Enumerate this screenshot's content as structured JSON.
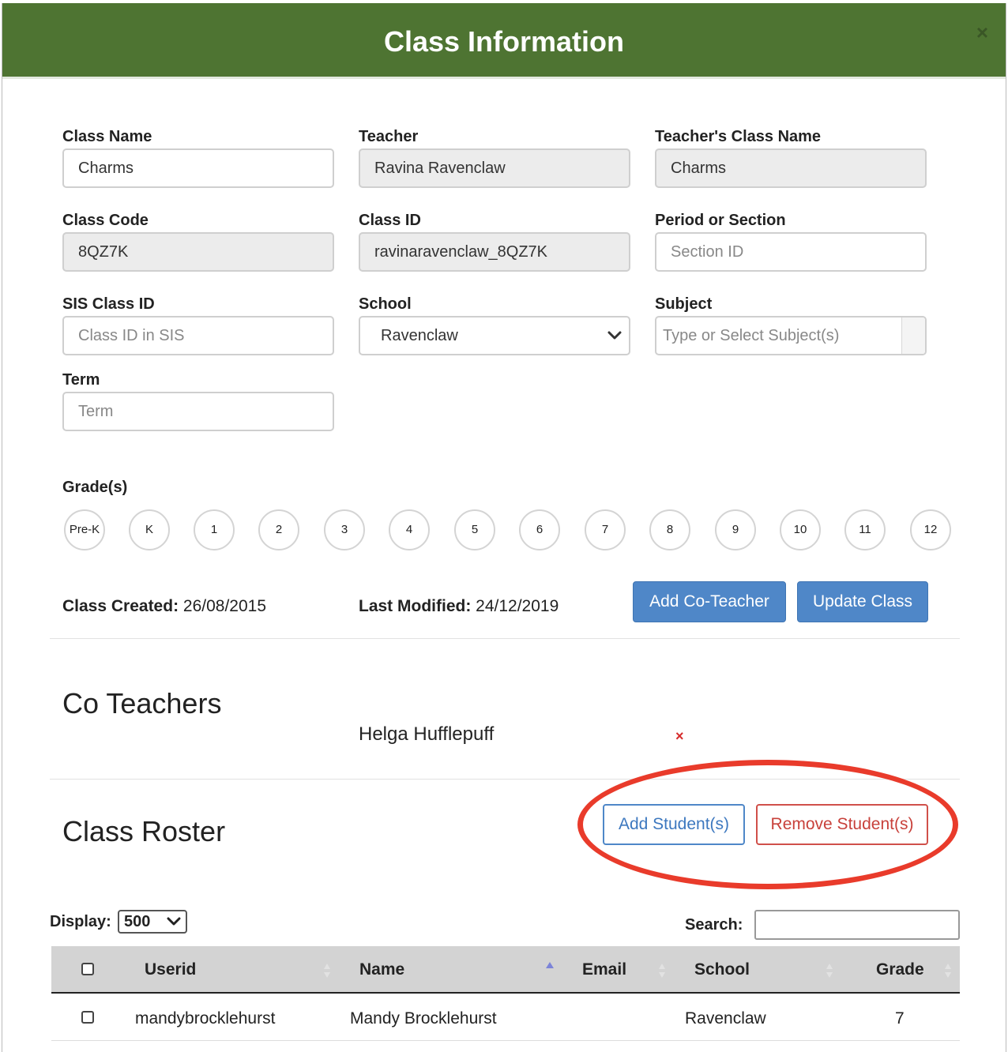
{
  "modal": {
    "title": "Class Information",
    "close_symbol": "×"
  },
  "fields": {
    "class_name": {
      "label": "Class Name",
      "value": "Charms"
    },
    "teacher": {
      "label": "Teacher",
      "value": "Ravina Ravenclaw"
    },
    "teachers_class_name": {
      "label": "Teacher's Class Name",
      "value": "Charms"
    },
    "class_code": {
      "label": "Class Code",
      "value": "8QZ7K"
    },
    "class_id": {
      "label": "Class ID",
      "value": "ravinaravenclaw_8QZ7K"
    },
    "period_or_section": {
      "label": "Period or Section",
      "placeholder": "Section ID"
    },
    "sis_class_id": {
      "label": "SIS Class ID",
      "placeholder": "Class ID in SIS"
    },
    "school": {
      "label": "School",
      "selected": "Ravenclaw"
    },
    "subject": {
      "label": "Subject",
      "placeholder": "Type or Select Subject(s)"
    },
    "term": {
      "label": "Term",
      "placeholder": "Term"
    }
  },
  "grades": {
    "label": "Grade(s)",
    "items": [
      "Pre-K",
      "K",
      "1",
      "2",
      "3",
      "4",
      "5",
      "6",
      "7",
      "8",
      "9",
      "10",
      "11",
      "12"
    ]
  },
  "meta": {
    "created_label": "Class Created:",
    "created_value": "26/08/2015",
    "modified_label": "Last Modified:",
    "modified_value": "24/12/2019"
  },
  "buttons": {
    "add_co_teacher": "Add Co-Teacher",
    "update_class": "Update Class",
    "add_students": "Add Student(s)",
    "remove_students": "Remove Student(s)"
  },
  "co_teachers": {
    "title": "Co Teachers",
    "items": [
      {
        "name": "Helga Hufflepuff",
        "remove_symbol": "×"
      }
    ]
  },
  "roster": {
    "title": "Class Roster",
    "display_label": "Display:",
    "display_value": "500",
    "search_label": "Search:",
    "columns": [
      "Userid",
      "Name",
      "Email",
      "School",
      "Grade"
    ],
    "rows": [
      {
        "userid": "mandybrocklehurst",
        "name": "Mandy Brocklehurst",
        "email": "",
        "school": "Ravenclaw",
        "grade": "7"
      }
    ]
  },
  "colors": {
    "header_green": "#4e7432",
    "primary_blue": "#4f87c8",
    "danger_red": "#c8413b",
    "highlight_ellipse": "#e93b2b"
  },
  "icons": {
    "close": "close-icon",
    "select_caret": "chevron-down-icon",
    "sort": "sort-icon",
    "sort_asc": "sort-asc-icon",
    "remove": "remove-icon"
  }
}
